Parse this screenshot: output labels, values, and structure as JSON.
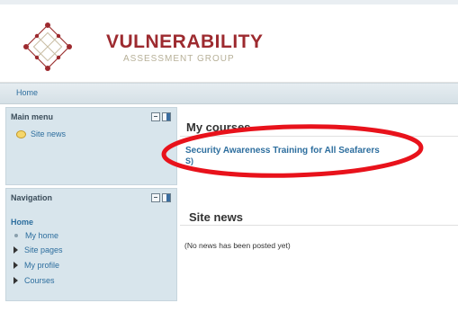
{
  "brand": {
    "title": "VULNERABILITY",
    "subtitle": "ASSESSMENT GROUP"
  },
  "breadcrumb": {
    "home": "Home"
  },
  "main_menu": {
    "title": "Main menu",
    "items": [
      {
        "label": "Site news",
        "icon": "speech-bubble-icon"
      }
    ]
  },
  "navigation": {
    "title": "Navigation",
    "home": "Home",
    "items": [
      {
        "label": "My home",
        "icon": "bullet-icon"
      },
      {
        "label": "Site pages",
        "icon": "expand-triangle-icon"
      },
      {
        "label": "My profile",
        "icon": "expand-triangle-icon"
      },
      {
        "label": "Courses",
        "icon": "expand-triangle-icon"
      }
    ]
  },
  "main": {
    "my_courses_title": "My courses",
    "course_name": "Security Awareness Training for All Seafarers",
    "course_extra": "S)",
    "site_news_title": "Site news",
    "empty_message": "(No news has been posted yet)"
  },
  "colors": {
    "brand_red": "#9d2a2f",
    "link_blue": "#2d6e9e",
    "sidebar_bg": "#d8e5ec",
    "annotation_red": "#e8121b"
  }
}
